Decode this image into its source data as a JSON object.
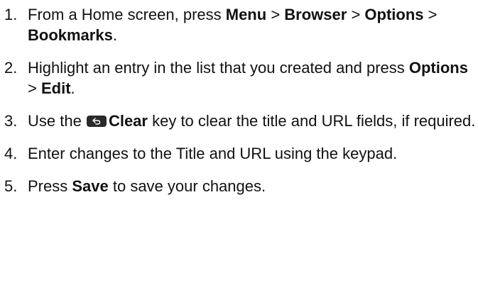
{
  "steps": [
    {
      "number": "1.",
      "parts": [
        "From a Home screen, press ",
        "Menu",
        " > ",
        "Browser",
        " > ",
        "Options",
        " > ",
        "Bookmarks",
        "."
      ]
    },
    {
      "number": "2.",
      "parts": [
        "Highlight an entry in the list that you created and press ",
        "Options",
        " > ",
        "Edit",
        "."
      ]
    },
    {
      "number": "3.",
      "parts": [
        "Use the ",
        "Clear",
        " key to clear the title and URL fields, if required."
      ],
      "key_icon": "clear-key-icon"
    },
    {
      "number": "4.",
      "parts": [
        "Enter changes to the Title and URL using the keypad."
      ]
    },
    {
      "number": "5.",
      "parts": [
        "Press ",
        "Save",
        " to save your changes."
      ]
    }
  ],
  "colors": {
    "text": "#111111",
    "key_background": "#2a2a2a",
    "key_glyph": "#ffffff"
  }
}
